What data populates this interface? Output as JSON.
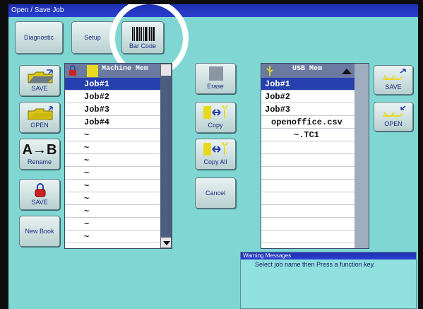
{
  "window": {
    "title": "Open / Save Job"
  },
  "toolbar": {
    "diagnostic": "Diagnostic",
    "setup": "Setup",
    "barcode": "Bar Code"
  },
  "left_buttons": {
    "save": "SAVE",
    "open": "OPEN",
    "rename": "Rename",
    "ab": "A→B",
    "save2": "SAVE",
    "new_book": "New Book"
  },
  "mid_buttons": {
    "erase": "Erase",
    "copy": "Copy",
    "copy_all": "Copy All",
    "cancel": "Cancel"
  },
  "right_buttons": {
    "save": "SAVE",
    "open": "OPEN"
  },
  "machine_list": {
    "header": "Machine Mem",
    "rows": [
      "Job#1",
      "Job#2",
      "Job#3",
      "Job#4",
      "~",
      "~",
      "~",
      "~",
      "~",
      "~",
      "~",
      "~",
      "~"
    ],
    "selected_index": 0
  },
  "usb_list": {
    "header": "USB Mem",
    "rows": [
      "Job#1",
      "Job#2",
      "Job#3",
      "openoffice.csv",
      "~.TC1"
    ],
    "selected_index": 0
  },
  "warning": {
    "title": "Warning Messages",
    "message": "Select job name then Press a function key."
  },
  "colors": {
    "screen": "#7fd6d3",
    "titlebar": "#2a3fd0",
    "selected_row": "#263fae",
    "list_header": "#6a7aa0",
    "folder": "#e8d820"
  },
  "icons": [
    "barcode-icon",
    "folder-save-icon",
    "folder-open-icon",
    "lock-icon",
    "usb-icon",
    "copy-arrow-icon"
  ]
}
